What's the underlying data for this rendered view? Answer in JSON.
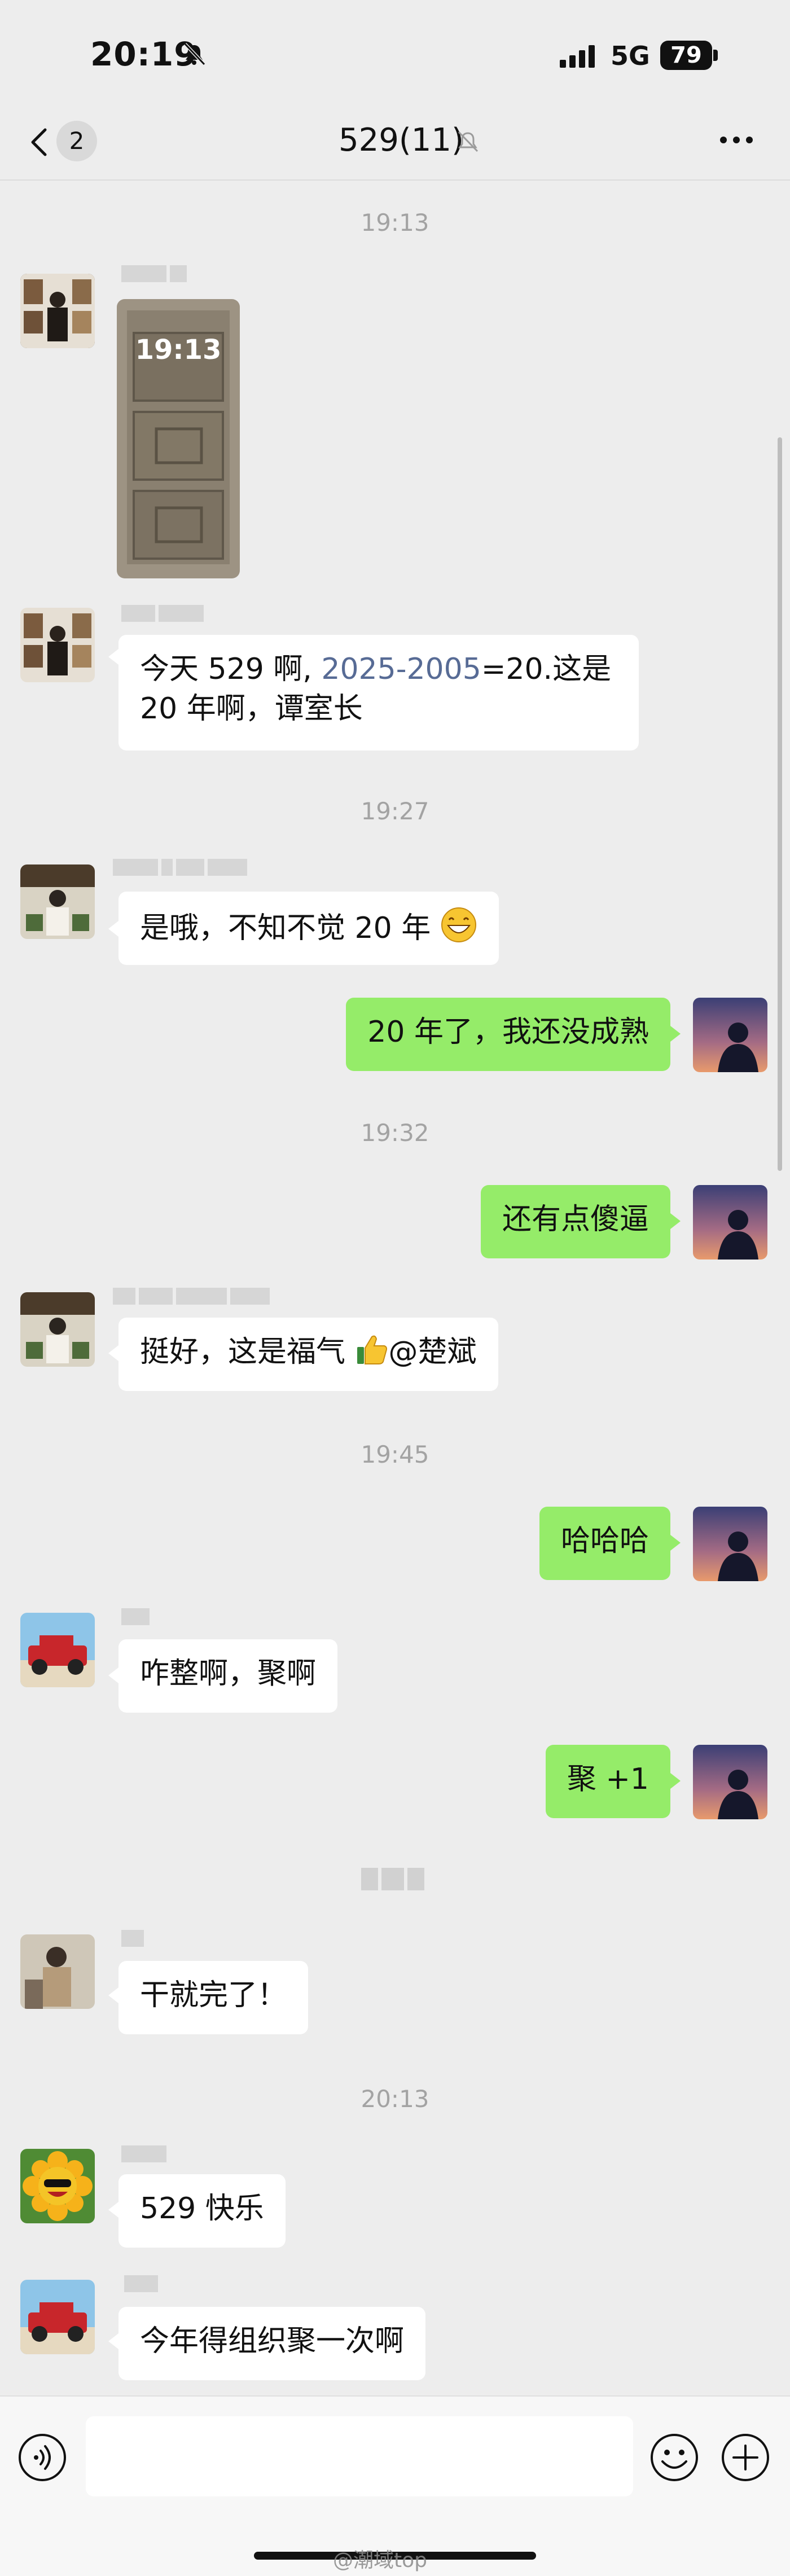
{
  "status_bar": {
    "time": "20:19",
    "network": "5G",
    "battery": "79"
  },
  "nav": {
    "back_badge": "2",
    "title": "529(11)"
  },
  "messages": {
    "ts1": "19:13",
    "m1": {
      "photo_time": "19:13"
    },
    "m2": {
      "prefix": "今天 529 啊, ",
      "link": "2025-2005",
      "suffix": "=20.这是",
      "line2": "20 年啊，谭室长"
    },
    "ts2": "19:27",
    "m3": {
      "text": "是哦，不知不觉 20 年"
    },
    "m4": {
      "text": "20 年了，我还没成熟"
    },
    "ts3": "19:32",
    "m5": {
      "text": "还有点傻逼"
    },
    "m6": {
      "text": "挺好，这是福气",
      "mention": "@楚斌"
    },
    "ts4": "19:45",
    "m7": {
      "text": "哈哈哈"
    },
    "m8": {
      "text": "咋整啊，聚啊"
    },
    "m9": {
      "text": "聚 +1"
    },
    "m10": {
      "text": "干就完了！"
    },
    "ts6": "20:13",
    "m11": {
      "text": "529 快乐"
    },
    "m12": {
      "text": "今年得组织聚一次啊"
    }
  },
  "footer": {
    "watermark": "@潮域top"
  },
  "icons": {
    "silent": "bell-slash-icon",
    "signal": "signal-bars-icon",
    "back": "chevron-left-icon",
    "mute": "bell-slash-icon",
    "more": "more-dots-icon",
    "voice": "voice-icon",
    "emoji": "emoji-icon",
    "plus": "plus-circle-icon"
  },
  "colors": {
    "outgoing_bubble": "#95ec69",
    "incoming_bubble": "#ffffff",
    "link": "#576b95",
    "background": "#ededed"
  }
}
